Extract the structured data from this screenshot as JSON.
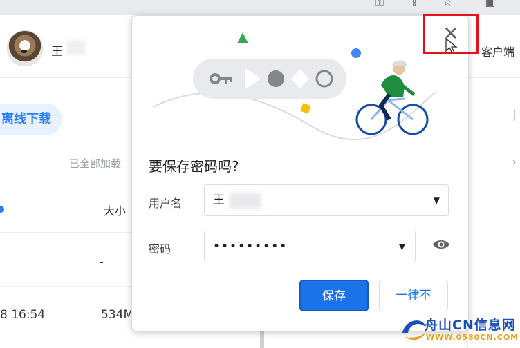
{
  "background": {
    "username": "王",
    "download_button": "离线下载",
    "loaded_text": "已全部加载",
    "size_header": "大小",
    "row_placeholder": "-",
    "row_time": "8 16:54",
    "row_size": "534M",
    "right_text": "客户端"
  },
  "dialog": {
    "title": "要保存密码吗?",
    "username_label": "用户名",
    "username_value": "王",
    "password_label": "密码",
    "password_value": "•••••••••",
    "save_button": "保存",
    "never_button": "一律不",
    "close_icon": "close-icon"
  },
  "watermark": {
    "name": "舟山CN信息网",
    "url": "WWW.0580CN.COM"
  },
  "colors": {
    "accent": "#1a73e8",
    "highlight": "#e3121b"
  }
}
